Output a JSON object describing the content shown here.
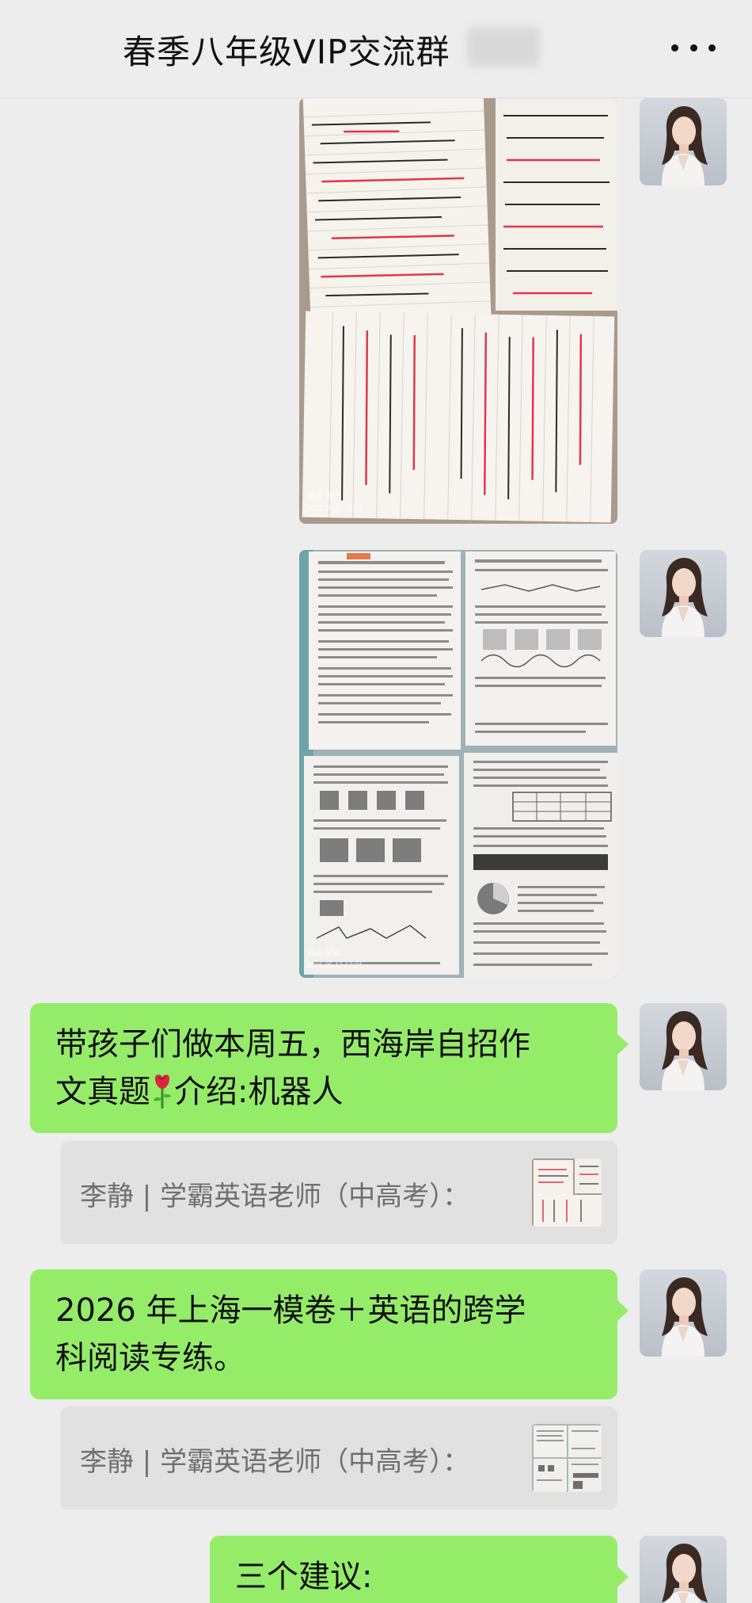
{
  "header": {
    "title": "春季八年级VIP交流群",
    "more_icon": "more-horizontal-icon"
  },
  "messages": [
    {
      "type": "image",
      "watermark": "vivo S50",
      "timestamp": "2026.05.17 17:21"
    },
    {
      "type": "image",
      "watermark": "vivo S50",
      "timestamp": "2026.05.17 17:21"
    },
    {
      "type": "text",
      "lines": [
        "带孩子们做本周五，西海岸自招作",
        "文真题",
        "介绍:机器人"
      ],
      "emoji": "rose-icon"
    },
    {
      "type": "quote",
      "sender": "李静 | 学霸英语老师（中高考）："
    },
    {
      "type": "text",
      "lines": [
        "2026 年上海一模卷＋英语的跨学",
        "科阅读专练。"
      ]
    },
    {
      "type": "quote",
      "sender": "李静 | 学霸英语老师（中高考）："
    },
    {
      "type": "text",
      "lines": [
        "三个建议:"
      ]
    }
  ],
  "colors": {
    "background": "#ededed",
    "bubble_self": "#95ec69",
    "quote_bg": "#e1e1e1",
    "quote_text": "#6f6f6f"
  }
}
